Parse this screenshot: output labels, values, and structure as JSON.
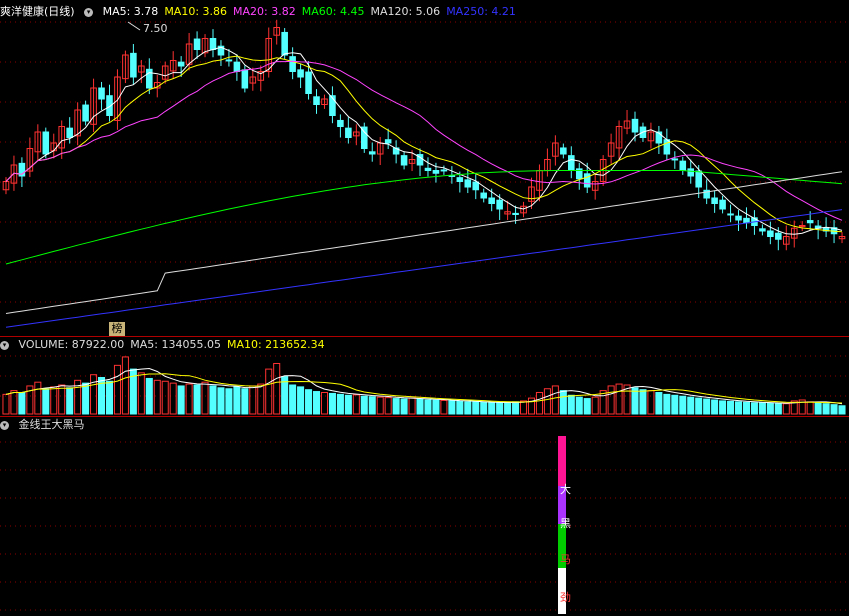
{
  "main_panel": {
    "title": "爽洋健康(日线)",
    "ma_labels": [
      {
        "text": "MA5: 3.78",
        "color": "#ffffff"
      },
      {
        "text": "MA10: 3.86",
        "color": "#ffff00"
      },
      {
        "text": "MA20: 3.82",
        "color": "#ff44ff"
      },
      {
        "text": "MA60: 4.45",
        "color": "#00ff00"
      },
      {
        "text": "MA120: 5.06",
        "color": "#dddddd"
      },
      {
        "text": "MA250: 4.21",
        "color": "#3333ff"
      }
    ],
    "peak_label": "7.50",
    "badge": "榜"
  },
  "volume_panel": {
    "labels": [
      {
        "text": "VOLUME: 87922.00",
        "color": "#dddddd"
      },
      {
        "text": "MA5: 134055.05",
        "color": "#dddddd"
      },
      {
        "text": "MA10: 213652.34",
        "color": "#ffff00"
      }
    ]
  },
  "indicator_panel": {
    "title": "金线王大黑马",
    "signal_chars": [
      "大",
      "黑",
      "马",
      "劲"
    ]
  },
  "colors": {
    "up": "#ff3232",
    "down": "#54ffff",
    "grid": "#8b0000",
    "separator": "#b00000"
  },
  "chart_data": {
    "type": "candlestick",
    "closes": [
      4.7,
      5.0,
      4.8,
      5.3,
      5.6,
      5.2,
      5.4,
      5.7,
      5.5,
      6.0,
      5.8,
      6.4,
      6.2,
      5.9,
      6.6,
      7.0,
      6.6,
      6.8,
      6.4,
      6.5,
      6.8,
      6.9,
      6.8,
      7.2,
      7.1,
      7.3,
      7.1,
      7.0,
      6.9,
      6.7,
      6.4,
      6.6,
      6.7,
      7.3,
      7.5,
      7.0,
      6.7,
      6.6,
      6.3,
      6.1,
      6.2,
      5.9,
      5.7,
      5.5,
      5.6,
      5.3,
      5.2,
      5.4,
      5.4,
      5.2,
      5.0,
      5.1,
      5.0,
      4.9,
      4.85,
      4.9,
      4.8,
      4.7,
      4.6,
      4.55,
      4.4,
      4.3,
      4.2,
      4.15,
      4.1,
      4.25,
      4.6,
      4.9,
      5.1,
      5.4,
      5.2,
      4.9,
      4.75,
      4.6,
      4.7,
      5.1,
      5.4,
      5.7,
      5.8,
      5.6,
      5.5,
      5.6,
      5.4,
      5.2,
      5.1,
      4.9,
      4.8,
      4.6,
      4.4,
      4.3,
      4.2,
      4.1,
      4.0,
      3.95,
      3.9,
      3.8,
      3.7,
      3.65,
      3.7,
      3.85,
      3.9,
      3.95,
      3.85,
      3.8,
      3.75,
      3.7
    ],
    "volumes": [
      210000,
      250000,
      230000,
      300000,
      340000,
      270000,
      290000,
      310000,
      280000,
      360000,
      330000,
      420000,
      390000,
      350000,
      520000,
      610000,
      480000,
      440000,
      380000,
      360000,
      350000,
      330000,
      300000,
      320000,
      310000,
      340000,
      300000,
      280000,
      270000,
      290000,
      270000,
      300000,
      320000,
      480000,
      540000,
      400000,
      310000,
      290000,
      260000,
      240000,
      230000,
      220000,
      210000,
      200000,
      205000,
      190000,
      185000,
      180000,
      175000,
      165000,
      160000,
      170000,
      160000,
      150000,
      148000,
      145000,
      140000,
      135000,
      130000,
      128000,
      125000,
      120000,
      118000,
      122000,
      130000,
      140000,
      170000,
      230000,
      270000,
      300000,
      250000,
      200000,
      180000,
      165000,
      180000,
      250000,
      300000,
      320000,
      310000,
      280000,
      260000,
      250000,
      230000,
      210000,
      200000,
      190000,
      180000,
      170000,
      160000,
      150000,
      140000,
      135000,
      130000,
      125000,
      120000,
      118000,
      115000,
      112000,
      110000,
      140000,
      150000,
      130000,
      118000,
      110000,
      100000,
      87922
    ],
    "ma5_last": 3.78,
    "ma10_last": 3.86,
    "ma20_last": 3.82,
    "ma60_last": 4.45,
    "ma120_last": 5.06,
    "ma250_last": 4.21,
    "volume_last": 87922.0,
    "volume_ma5_last": 134055.05,
    "volume_ma10_last": 213652.34
  }
}
